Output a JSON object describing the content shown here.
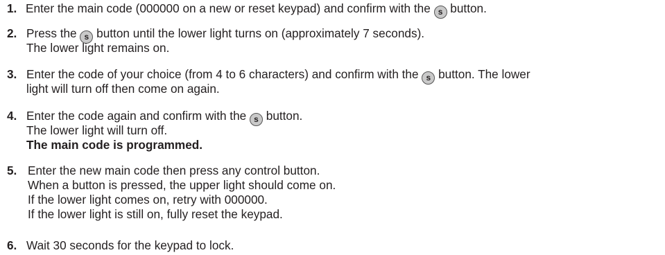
{
  "steps": [
    {
      "number": "1.",
      "lines": [
        [
          "Enter the main code (000000 on a new or reset keypad) and confirm with the ",
          "s",
          " button."
        ]
      ]
    },
    {
      "number": "2.",
      "lines": [
        [
          "Press the ",
          "s",
          " button until the lower light turns on (approximately 7 seconds)."
        ],
        [
          "The lower light remains on."
        ]
      ]
    },
    {
      "number": "3.",
      "lines": [
        [
          "Enter the code of your choice (from 4 to 6 characters) and confirm with the ",
          "s",
          " button.  The lower"
        ],
        [
          "light will turn off then come on again."
        ]
      ]
    },
    {
      "number": "4.",
      "lines": [
        [
          "Enter the code again and confirm with the ",
          "s",
          " button."
        ],
        [
          "The lower light will turn off."
        ],
        [
          "The main code is programmed."
        ]
      ]
    },
    {
      "number": "5.",
      "lines": [
        [
          "Enter the new main code then press any control button."
        ],
        [
          "When a button is pressed, the upper light should come on."
        ],
        [
          "If the lower light comes on, retry with 000000."
        ],
        [
          "If the lower light is still on, fully reset the keypad."
        ]
      ]
    },
    {
      "number": "6.",
      "lines": [
        [
          "Wait 30 seconds for the keypad to lock."
        ]
      ]
    }
  ],
  "button_icon_letter": "s"
}
